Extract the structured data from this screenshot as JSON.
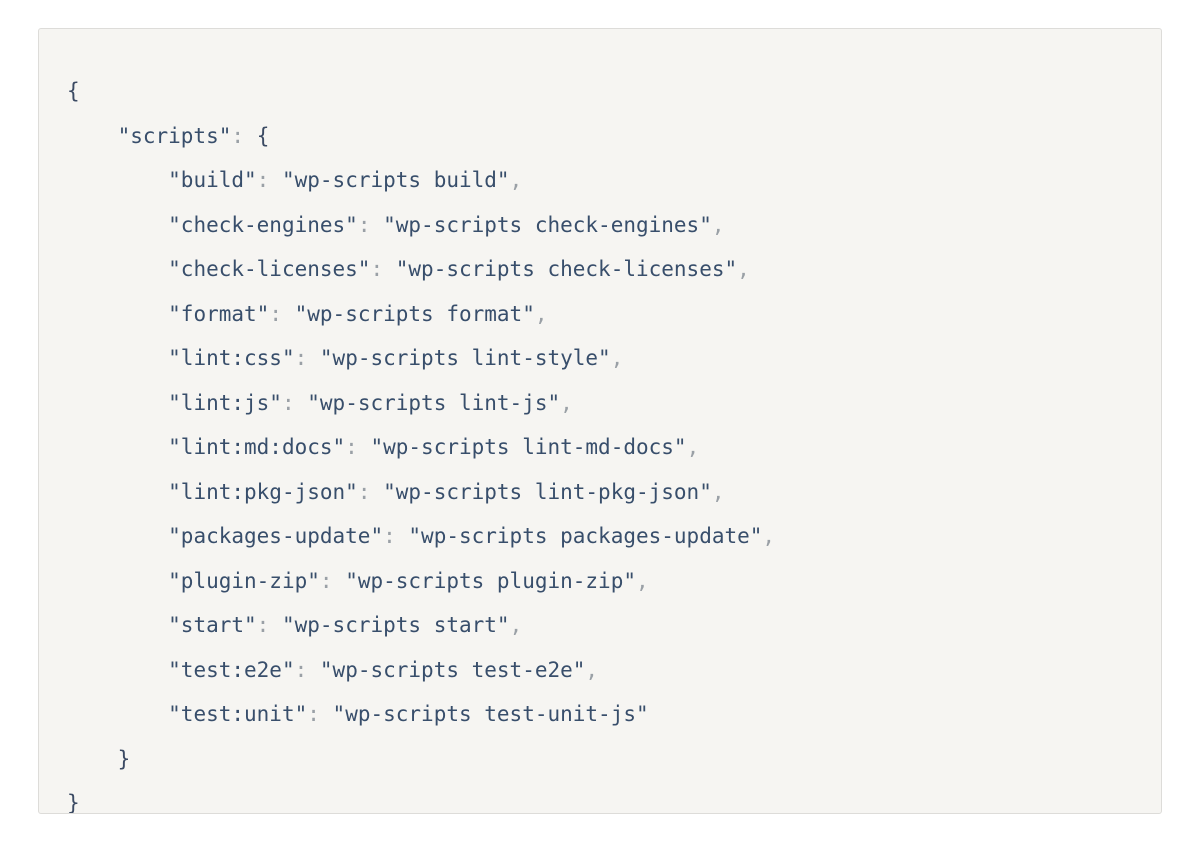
{
  "code": {
    "top_key": "scripts",
    "entries": [
      {
        "key": "build",
        "value": "wp-scripts build"
      },
      {
        "key": "check-engines",
        "value": "wp-scripts check-engines"
      },
      {
        "key": "check-licenses",
        "value": "wp-scripts check-licenses"
      },
      {
        "key": "format",
        "value": "wp-scripts format"
      },
      {
        "key": "lint:css",
        "value": "wp-scripts lint-style"
      },
      {
        "key": "lint:js",
        "value": "wp-scripts lint-js"
      },
      {
        "key": "lint:md:docs",
        "value": "wp-scripts lint-md-docs"
      },
      {
        "key": "lint:pkg-json",
        "value": "wp-scripts lint-pkg-json"
      },
      {
        "key": "packages-update",
        "value": "wp-scripts packages-update"
      },
      {
        "key": "plugin-zip",
        "value": "wp-scripts plugin-zip"
      },
      {
        "key": "start",
        "value": "wp-scripts start"
      },
      {
        "key": "test:e2e",
        "value": "wp-scripts test-e2e"
      },
      {
        "key": "test:unit",
        "value": "wp-scripts test-unit-js"
      }
    ],
    "indent1": "    ",
    "indent2": "        "
  }
}
